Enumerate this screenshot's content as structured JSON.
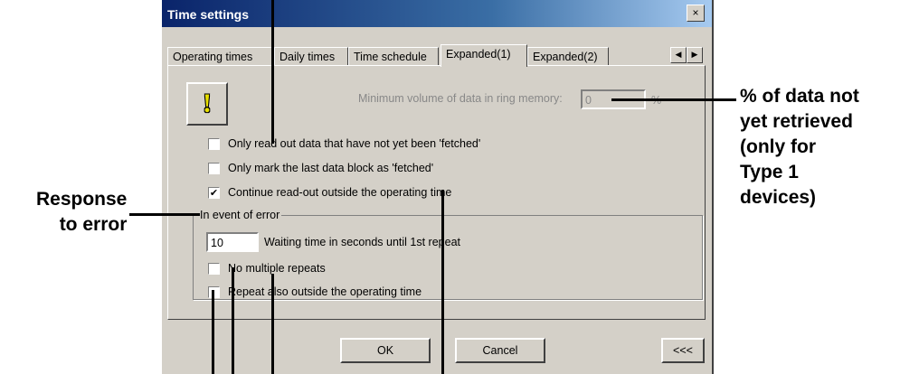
{
  "dialog": {
    "title": "Time settings",
    "close_label": "×"
  },
  "tabs": [
    {
      "label": "Operating times"
    },
    {
      "label": "Daily times"
    },
    {
      "label": "Time schedule"
    },
    {
      "label": "Expanded(1)"
    },
    {
      "label": "Expanded(2)"
    }
  ],
  "tab_nav": {
    "left": "◀",
    "right": "▶"
  },
  "warning_icon": "!",
  "min_volume": {
    "label": "Minimum volume of data in ring memory:",
    "value": "0",
    "unit": "%"
  },
  "options": {
    "only_read_out": {
      "label": "Only read out data that have not yet been 'fetched'",
      "checked": false
    },
    "only_mark_last": {
      "label": "Only mark the last data block as 'fetched'",
      "checked": false
    },
    "continue_readout": {
      "label": "Continue read-out outside the operating time",
      "checked": true,
      "mark": "✔"
    }
  },
  "error_group": {
    "title": "In event of error",
    "wait_value": "10",
    "wait_label": "Waiting time in seconds until 1st repeat",
    "no_multiple": {
      "label": "No multiple repeats",
      "checked": false
    },
    "repeat_outside": {
      "label": "Repeat also outside the operating time",
      "checked": false
    }
  },
  "buttons": {
    "ok": "OK",
    "cancel": "Cancel",
    "back": "<<<"
  },
  "callouts": {
    "response_line1": "Response",
    "response_line2": "to error",
    "pct_line1": "% of data not",
    "pct_line2": "yet retrieved",
    "pct_line3": "(only for",
    "pct_line4": "Type 1",
    "pct_line5": "devices)"
  }
}
